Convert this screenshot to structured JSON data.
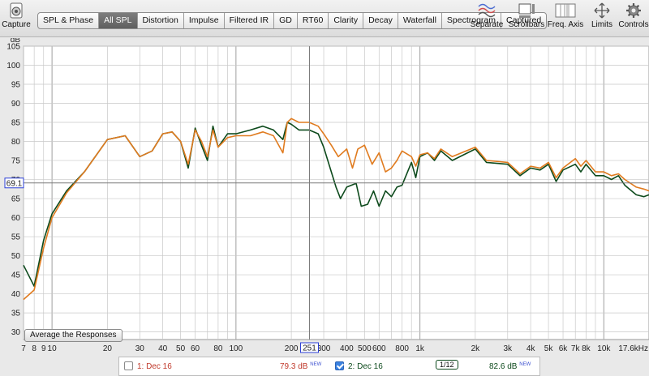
{
  "toolbar": {
    "capture_label": "Capture",
    "tabs": [
      {
        "label": "SPL & Phase",
        "active": false
      },
      {
        "label": "All SPL",
        "active": true
      },
      {
        "label": "Distortion",
        "active": false
      },
      {
        "label": "Impulse",
        "active": false
      },
      {
        "label": "Filtered IR",
        "active": false
      },
      {
        "label": "GD",
        "active": false
      },
      {
        "label": "RT60",
        "active": false
      },
      {
        "label": "Clarity",
        "active": false
      },
      {
        "label": "Decay",
        "active": false
      },
      {
        "label": "Waterfall",
        "active": false
      },
      {
        "label": "Spectrogram",
        "active": false
      },
      {
        "label": "Captured",
        "active": false
      }
    ],
    "right_buttons": [
      {
        "label": "Separate",
        "icon": "separate-icon"
      },
      {
        "label": "Scrollbars",
        "icon": "scrollbars-icon"
      },
      {
        "label": "Freq. Axis",
        "icon": "freq-axis-icon"
      },
      {
        "label": "Limits",
        "icon": "limits-icon"
      },
      {
        "label": "Controls",
        "icon": "gear-icon"
      }
    ]
  },
  "plot": {
    "y_unit": "dB",
    "y_ticks": [
      "105",
      "100",
      "95",
      "90",
      "85",
      "80",
      "75",
      "70",
      "65",
      "60",
      "55",
      "50",
      "45",
      "40",
      "35",
      "30"
    ],
    "x_ticks": [
      "7",
      "8",
      "9",
      "10",
      "20",
      "30",
      "40",
      "50",
      "60",
      "80",
      "100",
      "200",
      "300",
      "400",
      "500",
      "600",
      "800",
      "1k",
      "2k",
      "3k",
      "4k",
      "5k",
      "6k",
      "7k",
      "8k",
      "10k",
      "17.6kHz"
    ],
    "cursor_y_label": "69.1",
    "cursor_x_label": "251",
    "average_button_label": "Average the Responses",
    "colors": {
      "background": "#ffffff",
      "grid": "#c8c8c8",
      "series1": "#0d4a1c",
      "series2": "#e07b1f",
      "cursor": "#7a7a7a",
      "cursor_label": "#2b3fd6"
    }
  },
  "chart_data": {
    "type": "line",
    "xlabel": "",
    "ylabel": "dB",
    "xscale": "log",
    "xlim": [
      7,
      17600
    ],
    "ylim": [
      28,
      105
    ],
    "grid": true,
    "series": [
      {
        "name": "1: Dec 16",
        "color": "#0d4a1c",
        "points": [
          [
            7,
            47.5
          ],
          [
            8,
            42
          ],
          [
            9,
            54
          ],
          [
            10,
            61
          ],
          [
            12,
            67
          ],
          [
            15,
            72
          ],
          [
            20,
            80.5
          ],
          [
            25,
            81.5
          ],
          [
            30,
            76
          ],
          [
            35,
            77.5
          ],
          [
            40,
            82
          ],
          [
            45,
            82.5
          ],
          [
            50,
            80
          ],
          [
            55,
            73
          ],
          [
            60,
            83.5
          ],
          [
            65,
            79
          ],
          [
            70,
            75
          ],
          [
            75,
            84
          ],
          [
            80,
            78.5
          ],
          [
            90,
            82
          ],
          [
            100,
            82
          ],
          [
            120,
            83
          ],
          [
            140,
            84
          ],
          [
            160,
            83
          ],
          [
            180,
            80.5
          ],
          [
            190,
            85
          ],
          [
            200,
            84.5
          ],
          [
            220,
            83
          ],
          [
            250,
            83
          ],
          [
            280,
            82
          ],
          [
            300,
            78.5
          ],
          [
            330,
            72
          ],
          [
            350,
            68
          ],
          [
            370,
            65
          ],
          [
            400,
            68
          ],
          [
            450,
            69
          ],
          [
            480,
            63
          ],
          [
            520,
            63.5
          ],
          [
            560,
            67
          ],
          [
            600,
            63
          ],
          [
            650,
            67
          ],
          [
            700,
            65.5
          ],
          [
            750,
            68
          ],
          [
            800,
            68.5
          ],
          [
            900,
            74.5
          ],
          [
            950,
            70.5
          ],
          [
            1000,
            76
          ],
          [
            1100,
            77
          ],
          [
            1200,
            75
          ],
          [
            1300,
            77.5
          ],
          [
            1500,
            75
          ],
          [
            2000,
            78
          ],
          [
            2300,
            74.5
          ],
          [
            3000,
            74
          ],
          [
            3500,
            71
          ],
          [
            4000,
            73
          ],
          [
            4500,
            72.5
          ],
          [
            5000,
            74
          ],
          [
            5500,
            69.5
          ],
          [
            6000,
            72.5
          ],
          [
            7000,
            74
          ],
          [
            7500,
            72
          ],
          [
            8000,
            74
          ],
          [
            9000,
            71
          ],
          [
            10000,
            71
          ],
          [
            11000,
            70
          ],
          [
            12000,
            71
          ],
          [
            13000,
            68.5
          ],
          [
            15000,
            66
          ],
          [
            16500,
            65.5
          ],
          [
            17600,
            66
          ]
        ]
      },
      {
        "name": "2: Dec 16",
        "color": "#e07b1f",
        "points": [
          [
            7,
            38.5
          ],
          [
            8,
            41
          ],
          [
            9,
            52
          ],
          [
            10,
            60
          ],
          [
            12,
            66.5
          ],
          [
            15,
            72
          ],
          [
            20,
            80.5
          ],
          [
            25,
            81.5
          ],
          [
            30,
            76
          ],
          [
            35,
            77.5
          ],
          [
            40,
            82
          ],
          [
            45,
            82.5
          ],
          [
            50,
            80
          ],
          [
            55,
            74
          ],
          [
            60,
            83
          ],
          [
            65,
            80
          ],
          [
            70,
            76
          ],
          [
            75,
            83
          ],
          [
            80,
            78.5
          ],
          [
            90,
            81
          ],
          [
            100,
            81.5
          ],
          [
            120,
            81.5
          ],
          [
            140,
            82.5
          ],
          [
            160,
            81.5
          ],
          [
            180,
            77
          ],
          [
            190,
            85
          ],
          [
            200,
            86
          ],
          [
            220,
            85
          ],
          [
            250,
            85
          ],
          [
            280,
            84
          ],
          [
            300,
            82
          ],
          [
            330,
            79
          ],
          [
            360,
            76
          ],
          [
            400,
            78
          ],
          [
            430,
            73
          ],
          [
            460,
            78
          ],
          [
            500,
            79
          ],
          [
            550,
            74
          ],
          [
            600,
            77
          ],
          [
            650,
            72
          ],
          [
            700,
            73
          ],
          [
            750,
            75
          ],
          [
            800,
            77.5
          ],
          [
            900,
            76
          ],
          [
            950,
            73.5
          ],
          [
            1000,
            76.5
          ],
          [
            1100,
            77
          ],
          [
            1200,
            75.5
          ],
          [
            1300,
            78
          ],
          [
            1500,
            76
          ],
          [
            2000,
            78.5
          ],
          [
            2300,
            75
          ],
          [
            3000,
            74.5
          ],
          [
            3500,
            71.5
          ],
          [
            4000,
            73.5
          ],
          [
            4500,
            73
          ],
          [
            5000,
            74.5
          ],
          [
            5500,
            70.5
          ],
          [
            6000,
            73
          ],
          [
            7000,
            75.5
          ],
          [
            7500,
            73.5
          ],
          [
            8000,
            75
          ],
          [
            9000,
            72
          ],
          [
            10000,
            72
          ],
          [
            11000,
            71
          ],
          [
            12000,
            71.5
          ],
          [
            13000,
            70
          ],
          [
            15000,
            68
          ],
          [
            16500,
            67.5
          ],
          [
            17600,
            67
          ]
        ]
      }
    ]
  },
  "legend": {
    "items": [
      {
        "label": "1: Dec 16",
        "checked": false,
        "value": "79.3 dB",
        "tag": "NEW"
      },
      {
        "label": "2: Dec 16",
        "checked": true,
        "value": "82.6 dB",
        "tag": "NEW",
        "smoothing": "1/12"
      }
    ]
  }
}
